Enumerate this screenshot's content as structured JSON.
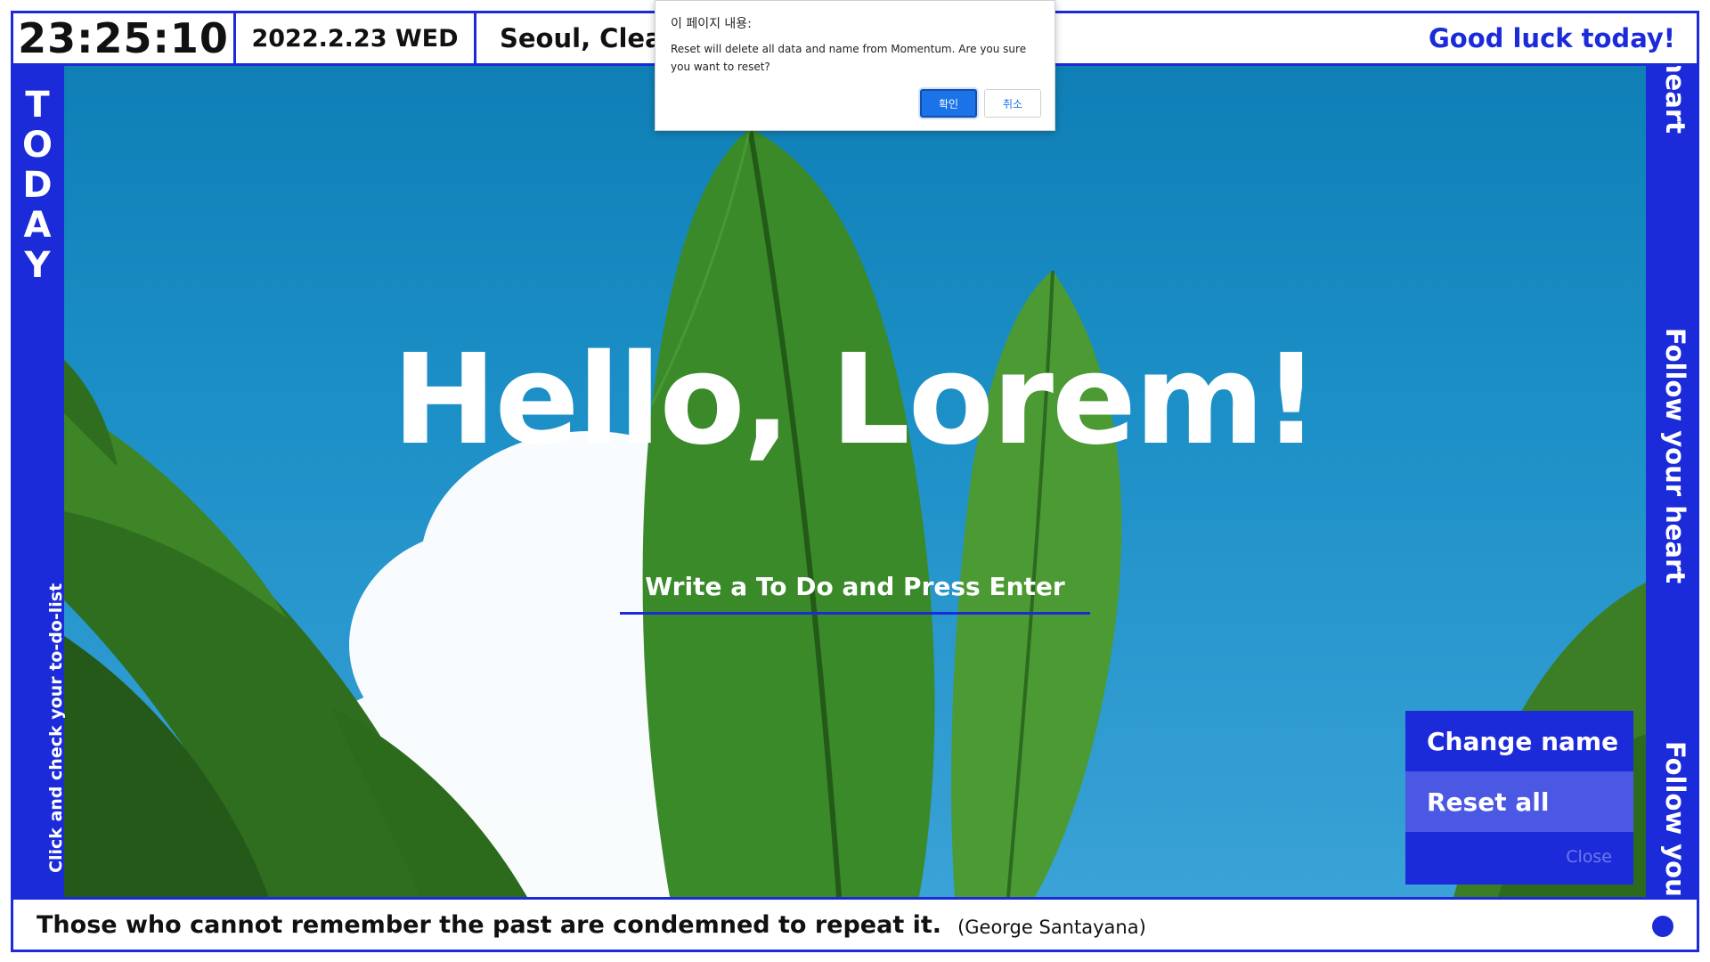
{
  "top_bar": {
    "clock": "23:25:10",
    "date": "2022.2.23 WED",
    "weather": "Seoul, Clear",
    "greeting": "Good luck today!"
  },
  "left_bar": {
    "today_letters": [
      "T",
      "O",
      "D",
      "A",
      "Y"
    ],
    "todo_hint": "Click and check your to-do-list"
  },
  "right_bar": {
    "motto_fragments": [
      "heart",
      "Follow your heart",
      "Follow your"
    ]
  },
  "main": {
    "greeting_heading": "Hello, Lorem!",
    "todo_placeholder": "Write a To Do and Press Enter"
  },
  "settings_menu": {
    "change_name": "Change name",
    "reset_all": "Reset all",
    "close": "Close"
  },
  "bottom_bar": {
    "quote": "Those who cannot remember the past are condemned to repeat it.",
    "author": "(George Santayana)"
  },
  "dialog": {
    "title": "이 페이지 내용:",
    "message": "Reset will delete all data and name from Momentum. Are you sure you want to reset?",
    "ok_label": "확인",
    "cancel_label": "취소"
  },
  "colors": {
    "accent": "#1c2bd9",
    "menu_highlight": "#4b58e3",
    "dialog_button": "#1a73e8"
  }
}
